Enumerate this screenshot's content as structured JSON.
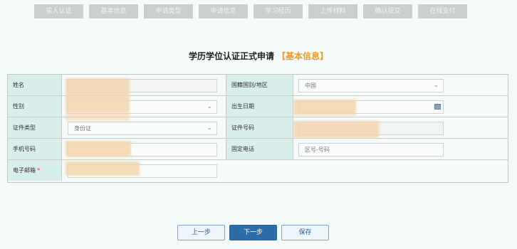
{
  "steps": [
    "实人认证",
    "基本信息",
    "申请类型",
    "申请信息",
    "学习经历",
    "上传材料",
    "确认提交",
    "在线支付"
  ],
  "title": {
    "main": "学历学位认证正式申请",
    "section": "【基本信息】"
  },
  "form": {
    "rows": [
      {
        "left_label": "姓名",
        "right_label": "国籍国别/地区",
        "right_value": "中国"
      },
      {
        "left_label": "性别",
        "right_label": "出生日期"
      },
      {
        "left_label": "证件类型",
        "left_value": "身份证",
        "right_label": "证件号码"
      },
      {
        "left_label": "手机号码",
        "right_label": "固定电话",
        "right_value": "区号-号码"
      },
      {
        "left_label": "电子邮箱",
        "required_mark": "*"
      }
    ]
  },
  "buttons": {
    "prev": "上一步",
    "next": "下一步",
    "save": "保存"
  },
  "colors": {
    "accent": "#f39a20",
    "primary": "#2c6da7",
    "label_bg": "#d8eeea"
  }
}
